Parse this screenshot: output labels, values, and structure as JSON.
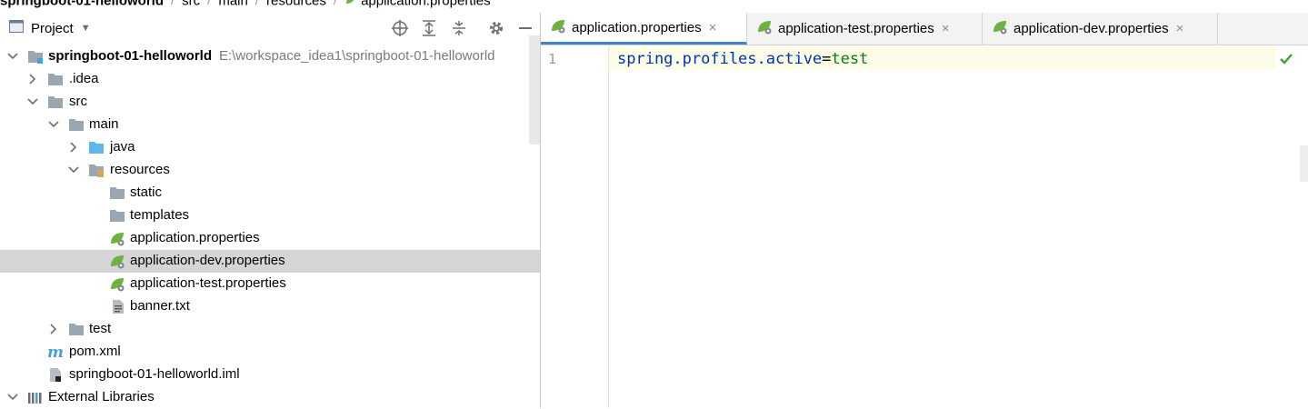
{
  "breadcrumb": {
    "project": "springboot-01-helloworld",
    "items": [
      "src",
      "main",
      "resources",
      "application.properties"
    ]
  },
  "project_panel": {
    "title": "Project",
    "toolbar_icons": [
      "locate-icon",
      "expand-all-icon",
      "collapse-all-icon",
      "gear-icon",
      "minimize-icon"
    ]
  },
  "tree": [
    {
      "label": "springboot-01-helloworld",
      "path": "E:\\workspace_idea1\\springboot-01-helloworld",
      "icon": "module-folder-icon",
      "expanded": true
    },
    {
      "label": ".idea",
      "icon": "folder-icon",
      "expanded": false
    },
    {
      "label": "src",
      "icon": "folder-icon",
      "expanded": true
    },
    {
      "label": "main",
      "icon": "folder-icon",
      "expanded": true
    },
    {
      "label": "java",
      "icon": "source-folder-icon",
      "expanded": false
    },
    {
      "label": "resources",
      "icon": "resources-folder-icon",
      "expanded": true
    },
    {
      "label": "static",
      "icon": "folder-icon"
    },
    {
      "label": "templates",
      "icon": "folder-icon"
    },
    {
      "label": "application.properties",
      "icon": "spring-properties-icon"
    },
    {
      "label": "application-dev.properties",
      "icon": "spring-properties-icon",
      "selected": true
    },
    {
      "label": "application-test.properties",
      "icon": "spring-properties-icon"
    },
    {
      "label": "banner.txt",
      "icon": "text-file-icon"
    },
    {
      "label": "test",
      "icon": "folder-icon",
      "expanded": false
    },
    {
      "label": "pom.xml",
      "icon": "maven-icon"
    },
    {
      "label": "springboot-01-helloworld.iml",
      "icon": "iml-file-icon"
    },
    {
      "label": "External Libraries",
      "icon": "libraries-icon",
      "expanded": true
    }
  ],
  "tabs": [
    {
      "label": "application.properties",
      "active": true
    },
    {
      "label": "application-test.properties",
      "active": false
    },
    {
      "label": "application-dev.properties",
      "active": false
    }
  ],
  "editor": {
    "line_number": "1",
    "code": {
      "key": "spring.profiles.active",
      "eq": "=",
      "value": "test"
    }
  },
  "colors": {
    "accent": "#4083c9",
    "selection": "#d5d5d5",
    "keyword": "#0033b3",
    "string": "#067d17",
    "spring_green": "#6db33f"
  }
}
